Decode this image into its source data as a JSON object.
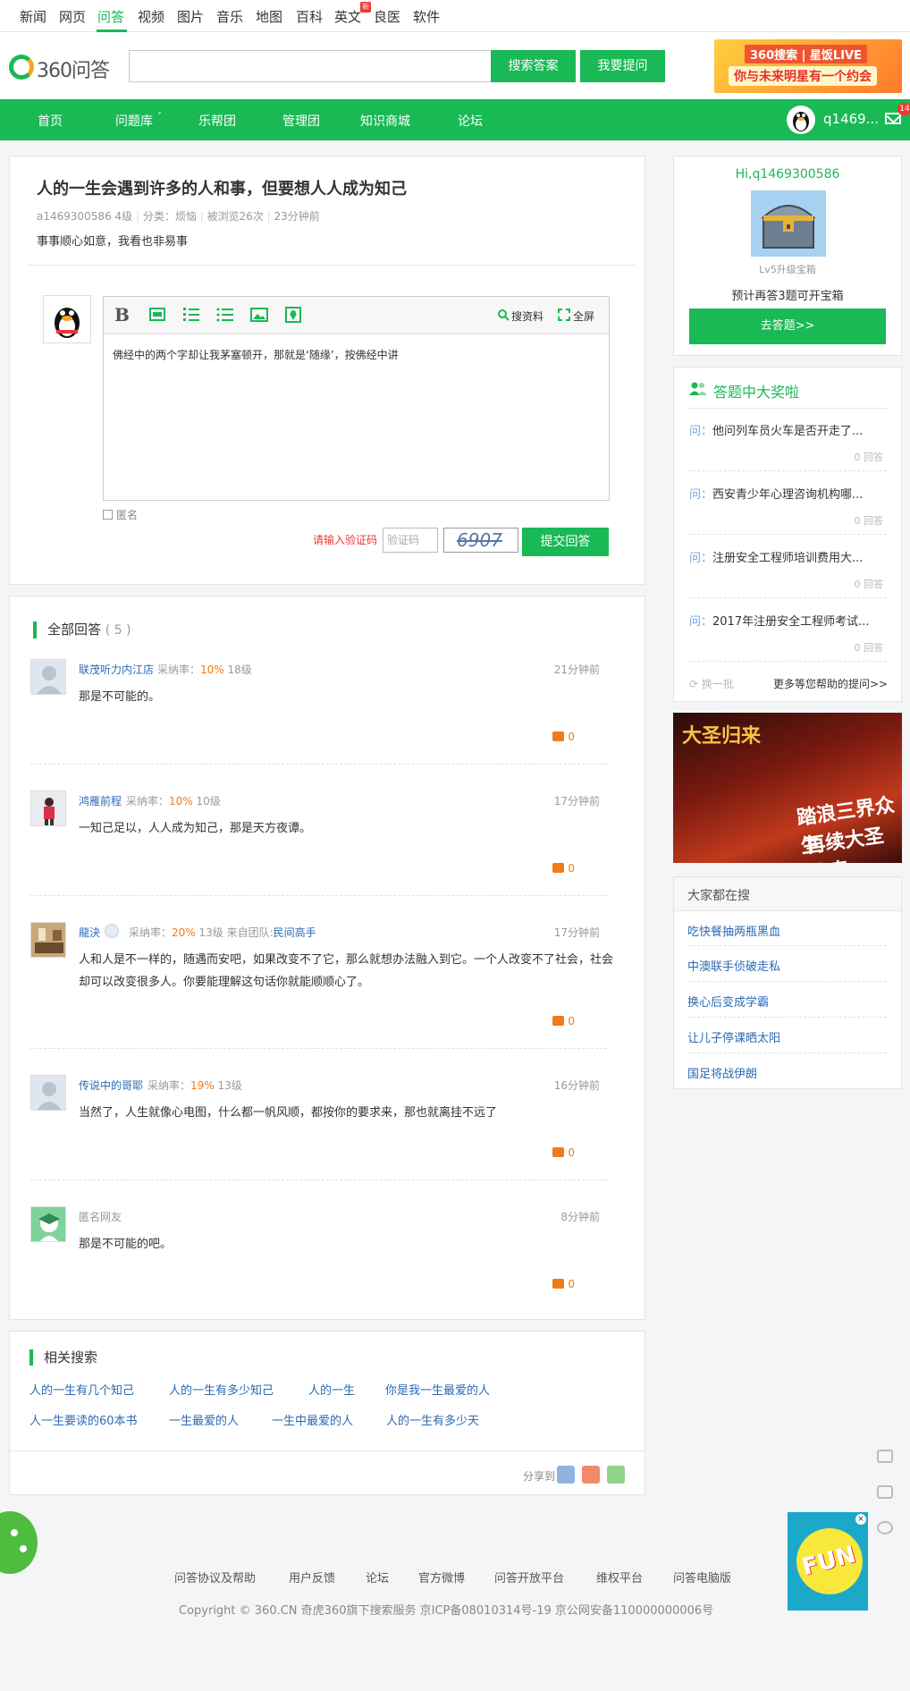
{
  "topnav": {
    "items": [
      "新闻",
      "网页",
      "问答",
      "视频",
      "图片",
      "音乐",
      "地图",
      "百科",
      "英文",
      "良医",
      "软件"
    ],
    "new_badge": "新"
  },
  "header": {
    "logo_text": "360问答",
    "search_value": "",
    "search_button": "搜索答案",
    "ask_button": "我要提问",
    "ad_line1": "360搜索 | 星饭LIVE",
    "ad_line2": "你与未来明星有一个约会"
  },
  "mainnav": {
    "items": [
      "首页",
      "问题库",
      "乐帮团",
      "管理团",
      "知识商城",
      "论坛"
    ],
    "user_name": "q1469...",
    "mail_count": "14"
  },
  "question": {
    "title": "人的一生会遇到许多的人和事，但要想人人成为知己",
    "author": "a1469300586",
    "level": "4级",
    "category": "分类：烦恼",
    "views": "被浏览26次",
    "time": "23分钟前",
    "description": "事事顺心如意，我看也非易事"
  },
  "editor": {
    "tools": {
      "bold": "B",
      "search_material": "搜资料",
      "fullscreen": "全屏"
    },
    "content": "佛经中的两个字却让我茅塞顿开，那就是‘随缘’，按佛经中讲",
    "anonymous_label": "匿名",
    "verify_label": "请输入验证码",
    "verify_placeholder": "验证码",
    "captcha_text": "6907",
    "submit_button": "提交回答"
  },
  "answers_section": {
    "title": "全部回答",
    "count": "( 5 )",
    "items": [
      {
        "name": "联茂听力内江店",
        "rate_label": "采纳率：",
        "rate": "10%",
        "level": "18级",
        "extra": "",
        "team": "",
        "time": "21分钟前",
        "text": "那是不可能的。",
        "likes": "0"
      },
      {
        "name": "鸿雁前程",
        "rate_label": "采纳率：",
        "rate": "10%",
        "level": "10级",
        "extra": "",
        "team": "",
        "time": "17分钟前",
        "text": "一知己足以，人人成为知己，那是天方夜谭。",
        "likes": "0"
      },
      {
        "name": "龍決",
        "rate_label": "采纳率：",
        "rate": "20%",
        "level": "13级",
        "extra": "来自团队:",
        "team": "民间高手",
        "time": "17分钟前",
        "text": "人和人是不一样的，随遇而安吧，如果改变不了它，那么就想办法融入到它。一个人改变不了社会，社会却可以改变很多人。你要能理解这句话你就能顺顺心了。",
        "likes": "0"
      },
      {
        "name": "传说中的哥耶",
        "rate_label": "采纳率：",
        "rate": "19%",
        "level": "13级",
        "extra": "",
        "team": "",
        "time": "16分钟前",
        "text": "当然了，人生就像心电图，什么都一帆风顺，都按你的要求来，那也就离挂不远了",
        "likes": "0"
      },
      {
        "name": "匿名网友",
        "rate_label": "",
        "rate": "",
        "level": "",
        "extra": "",
        "team": "",
        "time": "8分钟前",
        "text": "那是不可能的吧。",
        "likes": "0"
      }
    ]
  },
  "related": {
    "title": "相关搜索",
    "links": [
      "人的一生有几个知己",
      "人的一生有多少知己",
      "人的一生",
      "你是我一生最爱的人",
      "人一生要读的60本书",
      "一生最爱的人",
      "一生中最爱的人",
      "人的一生有多少天"
    ],
    "share_label": "分享到："
  },
  "sidebar": {
    "greeting": "Hi,q1469300586",
    "level_text": "Lv5升级宝箱",
    "estimate": "预计再答3题可开宝箱",
    "answer_button": "去答题>>",
    "prize_title": "答题中大奖啦",
    "prize_questions": [
      {
        "prefix": "问：",
        "text": "他问列车员火车是否开走了...",
        "count": "0 回答"
      },
      {
        "prefix": "问：",
        "text": "西安青少年心理咨询机构哪...",
        "count": "0 回答"
      },
      {
        "prefix": "问：",
        "text": "注册安全工程师培训费用大...",
        "count": "0 回答"
      },
      {
        "prefix": "问：",
        "text": "2017年注册安全工程师考试...",
        "count": "0 回答"
      }
    ],
    "refresh": "换一批",
    "more": "更多等您帮助的提问>>",
    "game_ad": {
      "title": "大圣归来",
      "line1": "踏浪三界众生",
      "line2": "再续大圣传奇"
    },
    "hot_title": "大家都在搜",
    "hot_links": [
      "吃快餐抽两瓶黑血",
      "中澳联手侦破走私",
      "换心后变成学霸",
      "让儿子停课晒太阳",
      "国足将战伊朗"
    ]
  },
  "fun_ad": {
    "text": "FUN",
    "close": "×"
  },
  "footer": {
    "links": [
      "问答协议及帮助",
      "用户反馈",
      "论坛",
      "官方微博",
      "问答开放平台",
      "维权平台",
      "问答电脑版"
    ],
    "copyright": "Copyright © 360.CN 奇虎360旗下搜索服务   京ICP备08010314号-19 京公网安备110000000006号"
  },
  "colors": {
    "brand_green": "#19b955",
    "link_blue": "#2b6ab4",
    "rate_orange": "#f07b1a",
    "alert_red": "#e53935"
  }
}
